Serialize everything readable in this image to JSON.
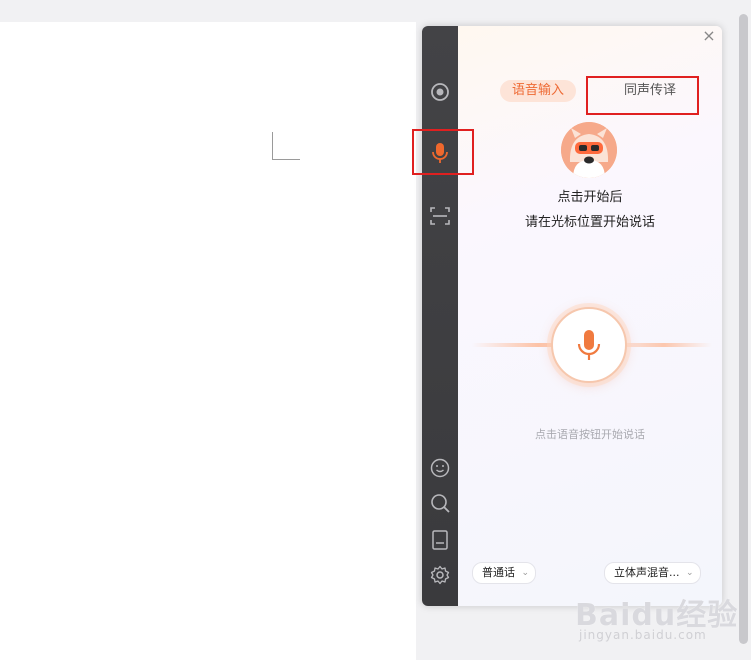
{
  "panel": {
    "close_label": "×",
    "tabs": [
      {
        "label": "语音输入",
        "active": true
      },
      {
        "label": "同声传译",
        "active": false
      }
    ],
    "hint_line1": "点击开始后",
    "hint_line2": "请在光标位置开始说话",
    "mic_hint": "点击语音按钮开始说话",
    "language_select": {
      "value": "普通话"
    },
    "audio_select": {
      "value": "立体声混音..."
    }
  },
  "rail": {
    "items": [
      {
        "name": "target-icon"
      },
      {
        "name": "microphone-icon",
        "active": true
      },
      {
        "name": "scan-icon"
      },
      {
        "name": "emoji-icon"
      },
      {
        "name": "search-icon"
      },
      {
        "name": "note-icon"
      },
      {
        "name": "settings-icon"
      }
    ]
  },
  "colors": {
    "accent": "#ee6a34",
    "rail_bg": "#3d3d40",
    "highlight": "#e02020"
  },
  "watermark": {
    "main": "Baidu经验",
    "sub": "jingyan.baidu.com"
  }
}
